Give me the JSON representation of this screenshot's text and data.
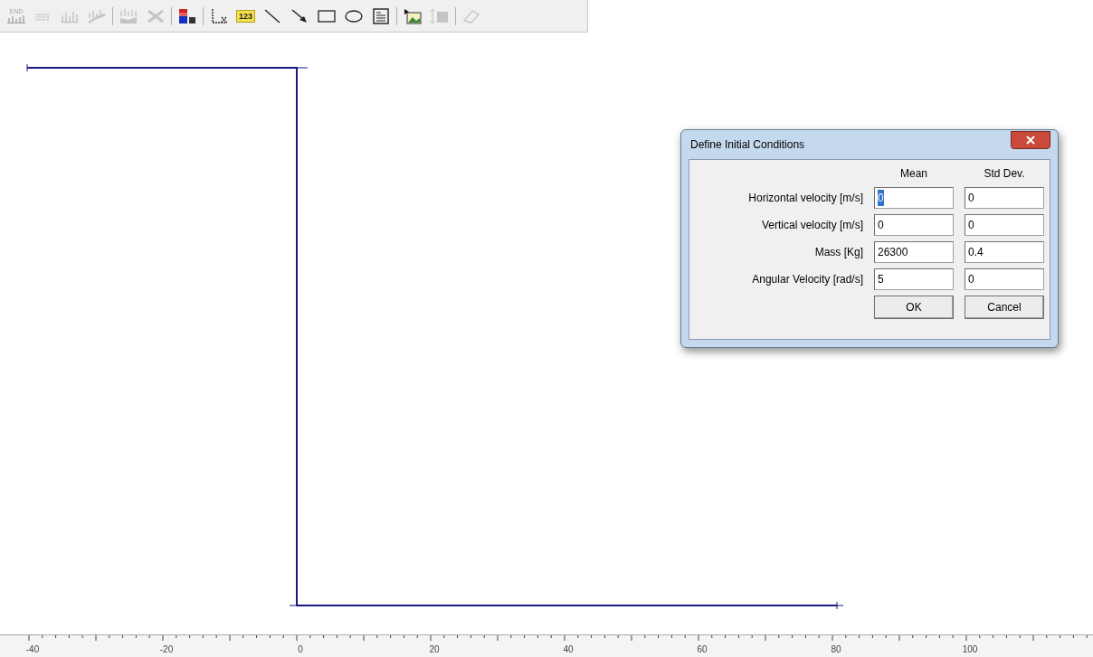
{
  "toolbar": {
    "groups": [
      [
        {
          "kind": "end",
          "label": "END",
          "disabled": true
        },
        {
          "kind": "legend",
          "disabled": true
        },
        {
          "kind": "bars",
          "disabled": true
        },
        {
          "kind": "trend",
          "disabled": true
        }
      ],
      [
        {
          "kind": "area",
          "disabled": true
        },
        {
          "kind": "delete",
          "disabled": true
        }
      ],
      [
        {
          "kind": "colors",
          "disabled": false
        }
      ],
      [
        {
          "kind": "axes",
          "disabled": false
        },
        {
          "kind": "ruler",
          "label": "123",
          "disabled": false
        },
        {
          "kind": "line",
          "disabled": false
        },
        {
          "kind": "arrow",
          "disabled": false
        },
        {
          "kind": "rect",
          "disabled": false
        },
        {
          "kind": "ellipse",
          "disabled": false
        },
        {
          "kind": "textbox",
          "disabled": false
        }
      ],
      [
        {
          "kind": "image",
          "disabled": false
        },
        {
          "kind": "resize",
          "disabled": true
        }
      ],
      [
        {
          "kind": "eraser",
          "disabled": true
        }
      ]
    ]
  },
  "dialog": {
    "title": "Define Initial Conditions",
    "columns": [
      "Mean",
      "Std Dev."
    ],
    "rows": [
      {
        "label": "Horizontal velocity [m/s]",
        "mean": "0",
        "std": "0",
        "mean_selected": true
      },
      {
        "label": "Vertical velocity [m/s]",
        "mean": "0",
        "std": "0",
        "mean_selected": false
      },
      {
        "label": "Mass [Kg]",
        "mean": "26300",
        "std": "0.4",
        "mean_selected": false
      },
      {
        "label": "Angular Velocity [rad/s]",
        "mean": "5",
        "std": "0",
        "mean_selected": false
      }
    ],
    "buttons": [
      "OK",
      "Cancel"
    ]
  },
  "ruler": {
    "labels": [
      "-40",
      "-20",
      "0",
      "20",
      "40",
      "60",
      "80",
      "100"
    ]
  }
}
